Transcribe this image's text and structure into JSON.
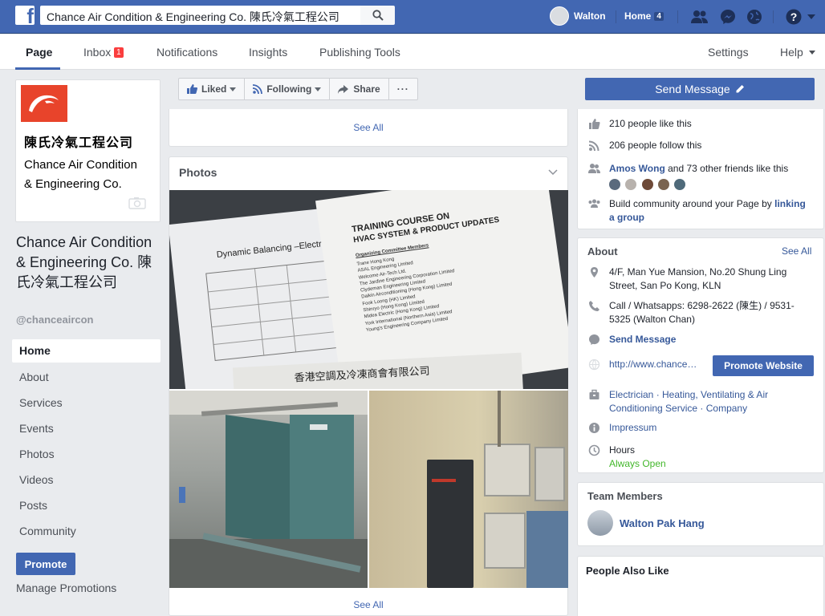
{
  "topbar": {
    "search_value": "Chance Air Condition & Engineering Co. 陳氏冷氣工程公司",
    "user_name": "Walton",
    "home_label": "Home",
    "home_count": "4"
  },
  "subnav": {
    "tabs": [
      {
        "label": "Page"
      },
      {
        "label": "Inbox",
        "badge": "1"
      },
      {
        "label": "Notifications"
      },
      {
        "label": "Insights"
      },
      {
        "label": "Publishing Tools"
      }
    ],
    "settings": "Settings",
    "help": "Help"
  },
  "profile": {
    "logo_zh": "陳氏冷氣工程公司",
    "logo_en_1": "Chance Air Condition",
    "logo_en_2": "& Engineering Co.",
    "title": "Chance Air Condition & Engineering Co. 陳氏冷氣工程公司",
    "handle": "@chanceaircon"
  },
  "left_nav": [
    "Home",
    "About",
    "Services",
    "Events",
    "Photos",
    "Videos",
    "Posts",
    "Community"
  ],
  "promote_label": "Promote",
  "manage_promotions": "Manage Promotions",
  "actions": {
    "liked": "Liked",
    "following": "Following",
    "share": "Share",
    "more": "···",
    "send_message": "Send Message"
  },
  "feed": {
    "see_all_top": "See All",
    "photos_title": "Photos",
    "see_all_bottom": "See All",
    "photo1_text": {
      "left_heading": "Dynamic Balancing –Electr",
      "right_heading_1": "TRAINING COURSE ON",
      "right_heading_2": "HVAC SYSTEM & PRODUCT UPDATES",
      "committee": "Organizing Committee Members",
      "members": [
        "Trane Hong Kong",
        "ASAL Engineering Limited",
        "Welcome Air-Tech Ltd.",
        "The Jardine Engineering Corporation Limited",
        "Clydeman Engineering Limited",
        "Daikin Airconditioning (Hong Kong) Limited",
        "Fook Loong (HK) Limited",
        "Shinryo (Hong Kong) Limited",
        "Midea Electric (Hong Kong) Limited",
        "York International (Northern Asia) Limited",
        "Young's Engineering Company Limited"
      ],
      "bottom_sign": "香港空調及冷凍商會有限公司"
    }
  },
  "community": {
    "likes": "210 people like this",
    "follows": "206 people follow this",
    "friend_name": "Amos Wong",
    "friends_rest": " and 73 other friends like this",
    "build_text": "Build community around your Page by ",
    "build_link": "linking a group"
  },
  "about": {
    "title": "About",
    "see_all": "See All",
    "address": "4/F, Man Yue Mansion, No.20 Shung Ling Street, San Po Kong, KLN",
    "phone": "Call / Whatsapps: 6298-2622 (陳生) / 9531-5325 (Walton Chan)",
    "send_message": "Send Message",
    "website": "http://www.chance…",
    "promote_website": "Promote Website",
    "categories": "Electrician · Heating, Ventilating & Air Conditioning Service · Company",
    "impressum": "Impressum",
    "hours_label": "Hours",
    "hours_value": "Always Open"
  },
  "team": {
    "title": "Team Members",
    "member": "Walton Pak Hang"
  },
  "people_also_like": {
    "title": "People Also Like"
  },
  "colors": {
    "fb_blue": "#4267b2",
    "link_blue": "#365899",
    "green": "#42b72a",
    "badge_red": "#fa3e3e"
  }
}
